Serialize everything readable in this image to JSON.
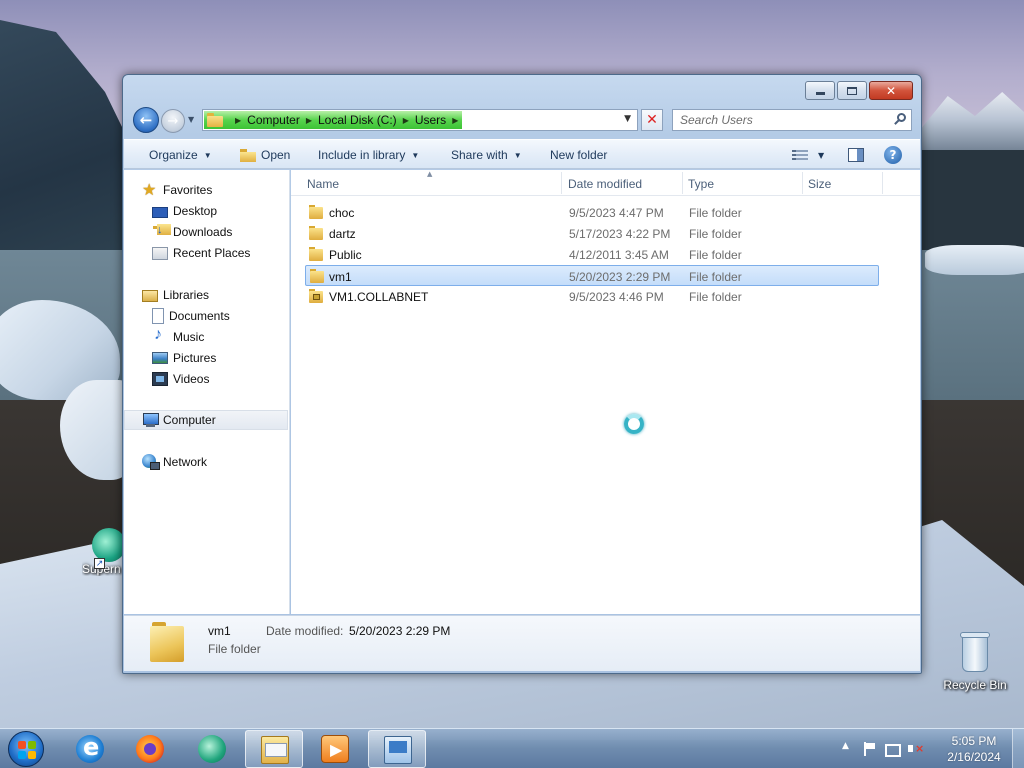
{
  "window": {
    "address": {
      "crumbs": [
        "Computer",
        "Local Disk (C:)",
        "Users"
      ]
    },
    "search": {
      "placeholder": "Search Users"
    },
    "toolbar": {
      "organize": "Organize",
      "open": "Open",
      "include_in_library": "Include in library",
      "share_with": "Share with",
      "new_folder": "New folder"
    },
    "nav": {
      "favorites": {
        "label": "Favorites",
        "items": [
          "Desktop",
          "Downloads",
          "Recent Places"
        ]
      },
      "libraries": {
        "label": "Libraries",
        "items": [
          "Documents",
          "Music",
          "Pictures",
          "Videos"
        ]
      },
      "computer": "Computer",
      "network": "Network"
    },
    "columns": {
      "name": "Name",
      "date": "Date modified",
      "type": "Type",
      "size": "Size"
    },
    "files": [
      {
        "name": "choc",
        "date": "9/5/2023 4:47 PM",
        "type": "File folder",
        "selected": false,
        "locked": false
      },
      {
        "name": "dartz",
        "date": "5/17/2023 4:22 PM",
        "type": "File folder",
        "selected": false,
        "locked": false
      },
      {
        "name": "Public",
        "date": "4/12/2011 3:45 AM",
        "type": "File folder",
        "selected": false,
        "locked": false
      },
      {
        "name": "vm1",
        "date": "5/20/2023 2:29 PM",
        "type": "File folder",
        "selected": true,
        "locked": false
      },
      {
        "name": "VM1.COLLABNET",
        "date": "9/5/2023 4:46 PM",
        "type": "File folder",
        "selected": false,
        "locked": true
      }
    ],
    "details": {
      "name": "vm1",
      "type": "File folder",
      "date_label": "Date modified:",
      "date_value": "5/20/2023 2:29 PM"
    }
  },
  "desktop": {
    "recycle_bin": "Recycle Bin",
    "partial_icon": "Supern"
  },
  "taskbar": {
    "time": "5:05 PM",
    "date": "2/16/2024"
  },
  "colors": {
    "selection": "#c4ddfa",
    "selection_border": "#7daeea",
    "address_green": "#57d34d",
    "close_red": "#d2543c"
  }
}
